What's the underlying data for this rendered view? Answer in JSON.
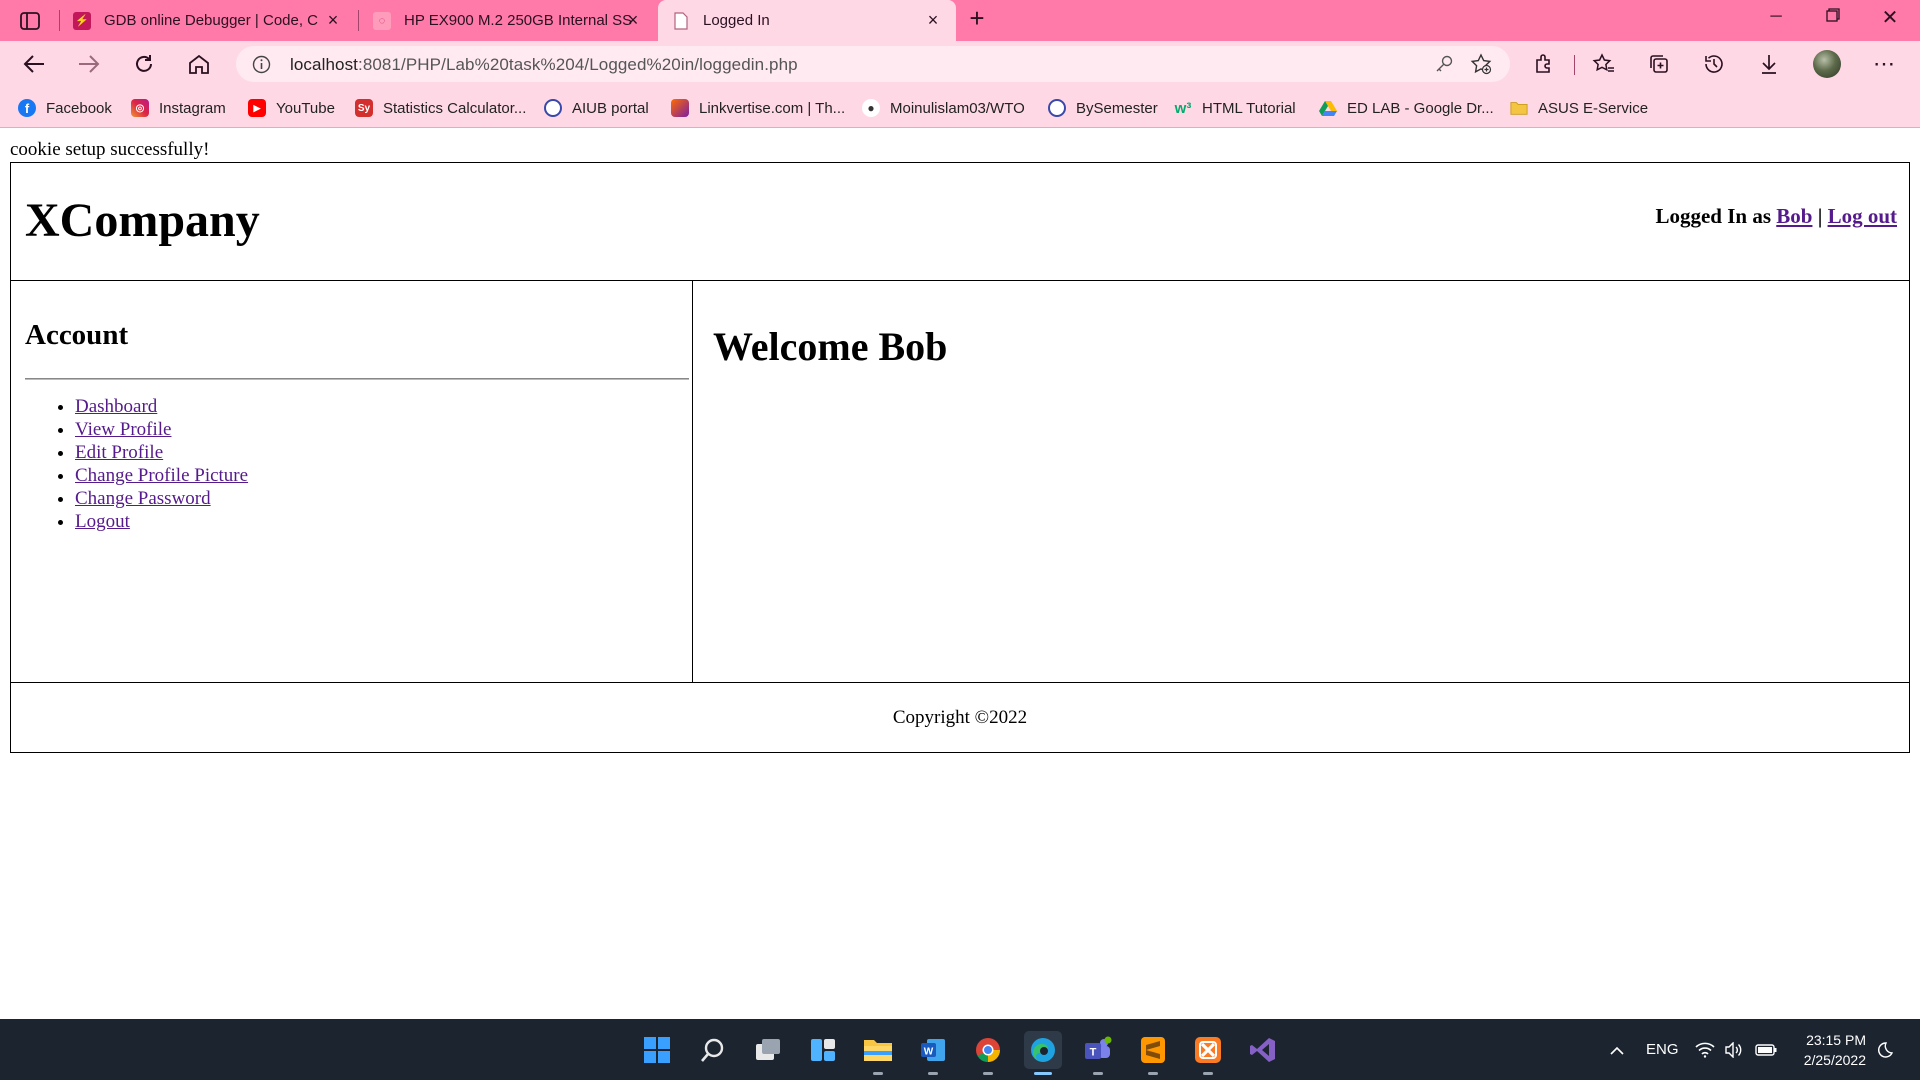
{
  "browser": {
    "tabs": [
      {
        "title": "GDB online Debugger | Code, Co",
        "icon": "gdb-icon"
      },
      {
        "title": "HP EX900 M.2 250GB Internal SS",
        "icon": "hp-icon"
      },
      {
        "title": "Logged In",
        "icon": "page-icon",
        "active": true
      }
    ],
    "url_host": "localhost",
    "url_path": ":8081/PHP/Lab%20task%204/Logged%20in/loggedin.php",
    "bookmarks": [
      {
        "label": "Facebook",
        "icon": "facebook-icon",
        "color": "#1877f2"
      },
      {
        "label": "Instagram",
        "icon": "instagram-icon",
        "color": "#d6249f"
      },
      {
        "label": "YouTube",
        "icon": "youtube-icon",
        "color": "#ff0000"
      },
      {
        "label": "Statistics Calculator...",
        "icon": "sy-icon",
        "color": "#d32f2f"
      },
      {
        "label": "AIUB portal",
        "icon": "aiub-icon",
        "color": "#3949ab"
      },
      {
        "label": "Linkvertise.com | Th...",
        "icon": "linkvertise-icon",
        "color": "#ff6a00"
      },
      {
        "label": "Moinulislam03/WTO",
        "icon": "github-icon",
        "color": "#ffffff"
      },
      {
        "label": "BySemester",
        "icon": "bysemester-icon",
        "color": "#3949ab"
      },
      {
        "label": "HTML Tutorial",
        "icon": "w3schools-icon",
        "color": "#04aa6d"
      },
      {
        "label": "ED LAB - Google Dr...",
        "icon": "google-drive-icon",
        "color": "#fbbc04"
      },
      {
        "label": "ASUS E-Service",
        "icon": "folder-icon",
        "color": "#f4c542"
      }
    ]
  },
  "page": {
    "cookie_message": "cookie setup successfully!",
    "brand": "XCompany",
    "logged_in_prefix": "Logged In as",
    "user_link": "Bob",
    "separator": "|",
    "logout_link": "Log out",
    "sidebar_heading": "Account",
    "menu": [
      "Dashboard",
      "View Profile",
      "Edit Profile",
      "Change Profile Picture",
      "Change Password",
      "Logout"
    ],
    "welcome": "Welcome Bob",
    "copyright": "Copyright ©2022"
  },
  "taskbar": {
    "language": "ENG",
    "time": "23:15 PM",
    "date": "2/25/2022"
  }
}
